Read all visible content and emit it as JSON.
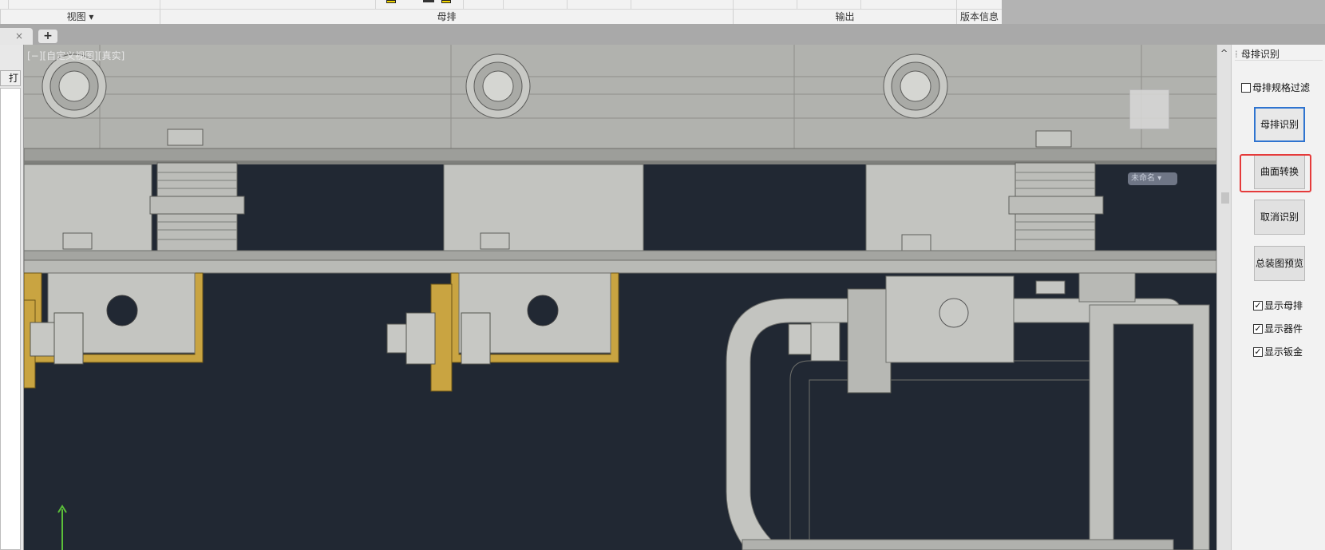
{
  "ribbon": {
    "panels": [
      "视图 ▾",
      "母排",
      "输出",
      "版本信息"
    ]
  },
  "tabs": {
    "close_glyph": "×",
    "add_glyph": "+"
  },
  "left_panel": {
    "open_button": "打开"
  },
  "viewport": {
    "label": "[−][自定义视图][真实]",
    "ucs_label": "未命名 ▾"
  },
  "right_panel": {
    "collapse_glyph": "^",
    "title": "母排识别",
    "filter_label": "母排规格过滤",
    "filter_checked": false,
    "buttons": {
      "recognize": "母排识别",
      "surface_convert": "曲面转换",
      "cancel_recognize": "取消识别",
      "assembly_preview": "总装图预览"
    },
    "checkboxes": [
      {
        "label": "显示母排",
        "checked": true
      },
      {
        "label": "显示器件",
        "checked": true
      },
      {
        "label": "显示钣金",
        "checked": true
      }
    ]
  },
  "colors": {
    "viewport_bg": "#212833",
    "model_gray": "#b4b5b1",
    "brass": "#c9a441",
    "highlight": "#e53b3b",
    "focus": "#2f74d0"
  }
}
